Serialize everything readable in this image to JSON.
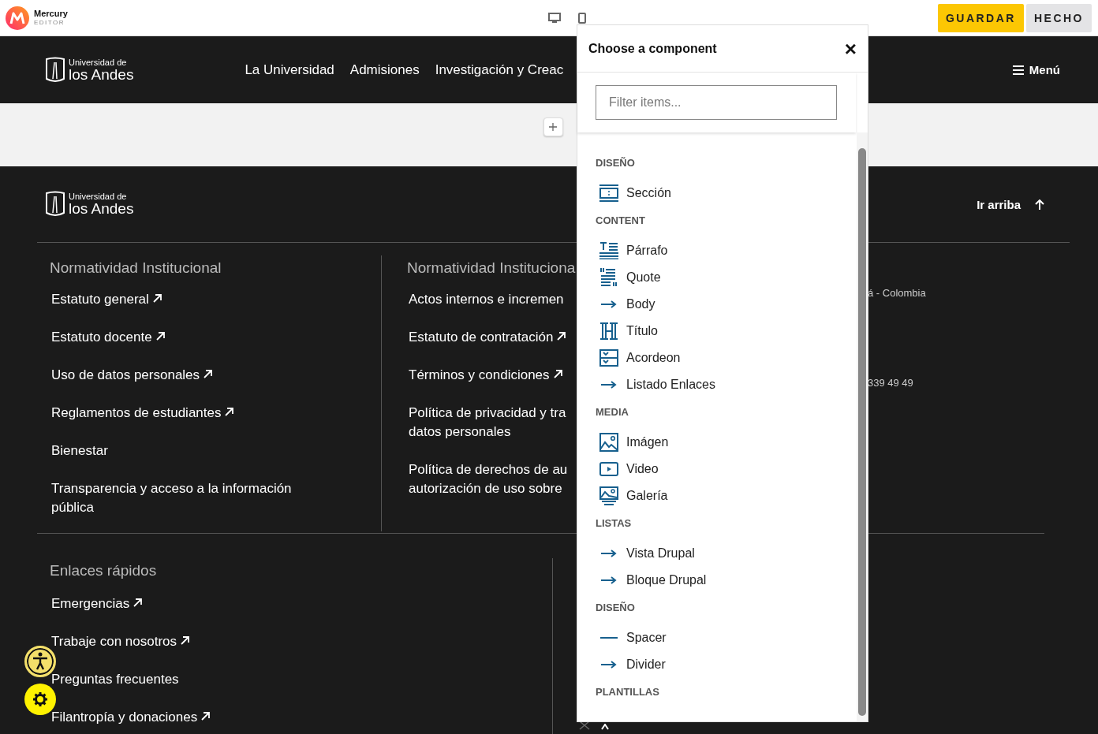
{
  "editor_bar": {
    "brand": "Mercury",
    "brand_sub": "EDITOR",
    "buttons": [
      {
        "label": "GUARDAR",
        "kind": "primary"
      },
      {
        "label": "HECHO",
        "kind": "secondary"
      }
    ]
  },
  "site_header": {
    "logo_top": "Universidad de",
    "logo_bottom": "los Andes",
    "nav": [
      "La Universidad",
      "Admisiones",
      "Investigación y Creac"
    ],
    "menu": "Menú"
  },
  "footer": {
    "logo_top": "Universidad de",
    "logo_bottom": "los Andes",
    "back_to_top": "Ir arriba",
    "columns": [
      {
        "heading": "Normatividad Institucional",
        "links": [
          {
            "label": "Estatuto general",
            "external": true
          },
          {
            "label": "Estatuto docente",
            "external": true
          },
          {
            "label": "Uso de datos personales",
            "external": true
          },
          {
            "label": "Reglamentos de estudiantes",
            "external": true
          },
          {
            "label": "Bienestar",
            "external": false
          },
          {
            "label": "Transparencia y acceso a la información pública",
            "external": false
          }
        ]
      },
      {
        "heading": "Normatividad Instituciona",
        "links": [
          {
            "label": "Actos internos e incremen",
            "external": false
          },
          {
            "label": "Estatuto de contratación",
            "external": true
          },
          {
            "label": "Términos y condiciones",
            "external": true
          },
          {
            "label": "Política de privacidad y tra datos personales",
            "external": false
          },
          {
            "label": "Política de derechos de au autorización de uso sobre",
            "external": false
          }
        ]
      }
    ],
    "contact": [
      "á - Colombia",
      "339 49 49"
    ],
    "quick_links": {
      "heading": "Enlaces rápidos",
      "links": [
        {
          "label": "Emergencias",
          "external": true
        },
        {
          "label": "Trabaje con nosotros",
          "external": true
        },
        {
          "label": "Preguntas frecuentes",
          "external": false
        },
        {
          "label": "Filantropía y donaciones",
          "external": true
        }
      ]
    }
  },
  "component_picker": {
    "title": "Choose a component",
    "close": "×",
    "filter": {
      "placeholder": "Filter items..."
    },
    "groups": [
      {
        "heading": "DISEÑO",
        "items": [
          {
            "label": "Sección",
            "kind": "section"
          }
        ]
      },
      {
        "heading": "CONTENT",
        "items": [
          {
            "label": "Párrafo",
            "kind": "paragraph"
          },
          {
            "label": "Quote",
            "kind": "quote"
          },
          {
            "label": "Body",
            "kind": "link"
          },
          {
            "label": "Título",
            "kind": "title"
          },
          {
            "label": "Acordeon",
            "kind": "accordion"
          },
          {
            "label": "Listado Enlaces",
            "kind": "link"
          }
        ]
      },
      {
        "heading": "MEDIA",
        "items": [
          {
            "label": "Imágen",
            "kind": "image"
          },
          {
            "label": "Video",
            "kind": "video"
          },
          {
            "label": "Galería",
            "kind": "gallery"
          }
        ]
      },
      {
        "heading": "LISTAS",
        "items": [
          {
            "label": "Vista Drupal",
            "kind": "link"
          },
          {
            "label": "Bloque Drupal",
            "kind": "link"
          }
        ]
      },
      {
        "heading": "DISEÑO",
        "items": [
          {
            "label": "Spacer",
            "kind": "spacer"
          },
          {
            "label": "Divider",
            "kind": "link"
          }
        ]
      },
      {
        "heading": "PLANTILLAS"
      }
    ]
  }
}
